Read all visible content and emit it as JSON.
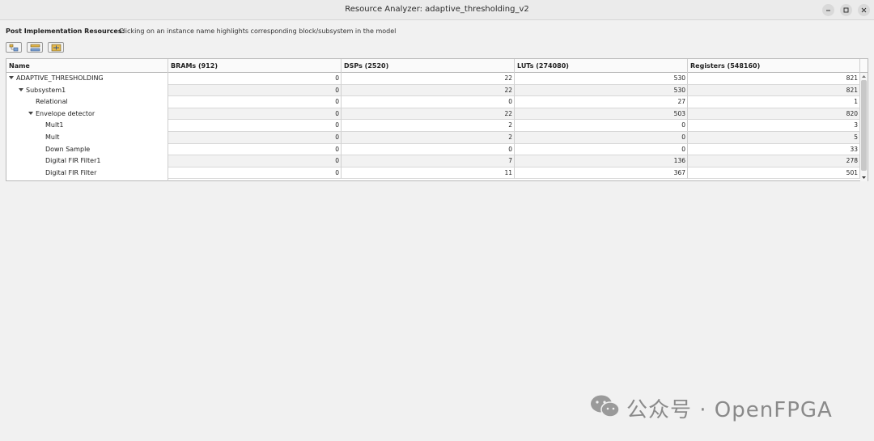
{
  "window": {
    "title": "Resource Analyzer: adaptive_thresholding_v2"
  },
  "info": {
    "label": "Post Implementation Resources:",
    "text": "Clicking on an instance name highlights corresponding block/subsystem in the model"
  },
  "toolbar": {
    "icons": [
      "collapse-all-icon",
      "expand-all-icon",
      "highlight-icon"
    ]
  },
  "table": {
    "columns": [
      "Name",
      "BRAMs (912)",
      "DSPs (2520)",
      "LUTs (274080)",
      "Registers (548160)"
    ],
    "rows": [
      {
        "name": "ADAPTIVE_THRESHOLDING",
        "level": 0,
        "expandable": true,
        "values": [
          "0",
          "22",
          "530",
          "821"
        ]
      },
      {
        "name": "Subsystem1",
        "level": 1,
        "expandable": true,
        "values": [
          "0",
          "22",
          "530",
          "821"
        ]
      },
      {
        "name": "Relational",
        "level": 2,
        "expandable": false,
        "values": [
          "0",
          "0",
          "27",
          "1"
        ]
      },
      {
        "name": "Envelope detector",
        "level": 2,
        "expandable": true,
        "values": [
          "0",
          "22",
          "503",
          "820"
        ]
      },
      {
        "name": "Mult1",
        "level": 3,
        "expandable": false,
        "values": [
          "0",
          "2",
          "0",
          "3"
        ]
      },
      {
        "name": "Mult",
        "level": 3,
        "expandable": false,
        "values": [
          "0",
          "2",
          "0",
          "5"
        ]
      },
      {
        "name": "Down Sample",
        "level": 3,
        "expandable": false,
        "values": [
          "0",
          "0",
          "0",
          "33"
        ]
      },
      {
        "name": "Digital FIR Filter1",
        "level": 3,
        "expandable": false,
        "values": [
          "0",
          "7",
          "136",
          "278"
        ]
      },
      {
        "name": "Digital FIR Filter",
        "level": 3,
        "expandable": false,
        "values": [
          "0",
          "11",
          "367",
          "501"
        ]
      }
    ]
  },
  "watermark": {
    "text": "公众号 · OpenFPGA"
  }
}
